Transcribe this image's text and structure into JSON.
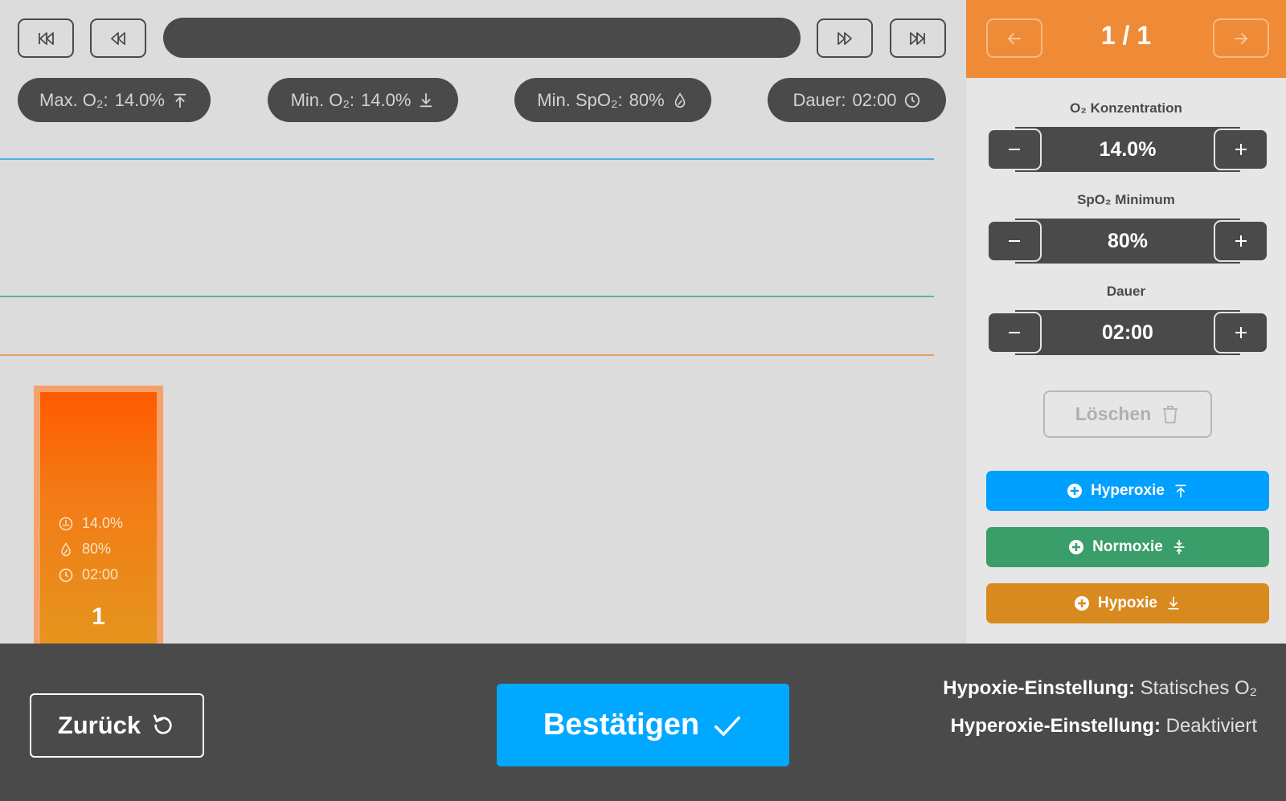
{
  "stats": {
    "max_o2": {
      "label": "Max. O₂:",
      "value": "14.0%"
    },
    "min_o2": {
      "label": "Min. O₂:",
      "value": "14.0%"
    },
    "min_spo2": {
      "label": "Min. SpO₂:",
      "value": "80%"
    },
    "duration": {
      "label": "Dauer:",
      "value": "02:00"
    }
  },
  "block": {
    "o2": "14.0%",
    "spo2": "80%",
    "duration": "02:00",
    "number": "1",
    "color": "#ff5a00"
  },
  "reference_lines": {
    "hyperoxia_color": "#4ab0e8",
    "normoxia_color": "#5fb98a",
    "hypoxia_color": "#e0a060"
  },
  "side": {
    "page_indicator": "1 / 1",
    "o2": {
      "label": "O₂ Konzentration",
      "value": "14.0%"
    },
    "spo2": {
      "label": "SpO₂ Minimum",
      "value": "80%"
    },
    "duration": {
      "label": "Dauer",
      "value": "02:00"
    },
    "delete_label": "Löschen",
    "add_hyperoxia": "Hyperoxie",
    "add_normoxia": "Normoxie",
    "add_hypoxia": "Hypoxie"
  },
  "colors": {
    "accent_orange": "#ef8b36",
    "hyperoxia": "#00a0ff",
    "normoxia": "#3a9e6a",
    "hypoxia": "#d98a1e",
    "confirm": "#00a8ff"
  },
  "bottom": {
    "back_label": "Zurück",
    "confirm_label": "Bestätigen",
    "hypoxia_setting_label": "Hypoxie-Einstellung:",
    "hypoxia_setting_value": "Statisches O₂",
    "hyperoxia_setting_label": "Hyperoxie-Einstellung:",
    "hyperoxia_setting_value": "Deaktiviert"
  }
}
